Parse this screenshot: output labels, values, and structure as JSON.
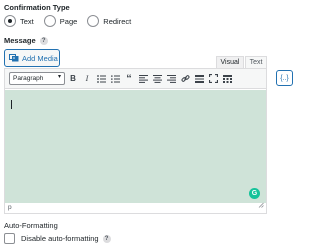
{
  "confirmation": {
    "title": "Confirmation Type",
    "options": [
      {
        "label": "Text",
        "selected": true
      },
      {
        "label": "Page",
        "selected": false
      },
      {
        "label": "Redirect",
        "selected": false
      }
    ]
  },
  "message": {
    "label": "Message",
    "help_icon": "?"
  },
  "media": {
    "add_label": "Add Media",
    "icon": "media-icon"
  },
  "editor_tabs": {
    "visual": "Visual",
    "text": "Text",
    "active": "Visual"
  },
  "toolbar": {
    "format_value": "Paragraph",
    "buttons": [
      "bold",
      "italic",
      "bullet-list",
      "numbered-list",
      "blockquote",
      "align-left",
      "align-center",
      "align-right",
      "link",
      "horizontal-rule",
      "fullscreen",
      "toolbar-toggle"
    ],
    "bold_glyph": "B",
    "italic_glyph": "I",
    "quote_glyph": "“"
  },
  "editor": {
    "status_path": "p",
    "background": "#cfe3d8",
    "grammarly_glyph": "G"
  },
  "merge_tags": {
    "glyph": "{..}"
  },
  "autoformat": {
    "title": "Auto-Formatting",
    "checkbox_label": "Disable auto-formatting",
    "checked": false,
    "help_icon": "?"
  },
  "colors": {
    "accent": "#2271b1",
    "grammarly": "#15c39a"
  }
}
